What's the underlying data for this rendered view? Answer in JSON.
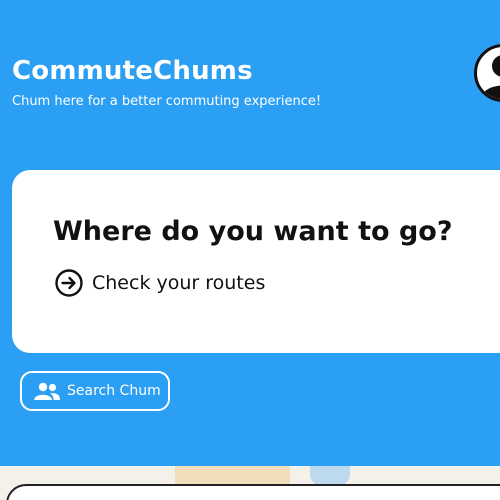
{
  "header": {
    "app_title": "CommuteChums",
    "subtitle": "Chum here for a better commuting experience!"
  },
  "avatar": {
    "icon": "user-avatar-icon"
  },
  "destination_card": {
    "title": "Where do you want to go?",
    "check_routes": {
      "label": "Check your routes",
      "icon": "arrow-right-circle-icon"
    }
  },
  "search_chum": {
    "label": "Search Chum",
    "icon": "group-icon"
  },
  "colors": {
    "primary": "#2b9ff3",
    "card": "#ffffff",
    "text": "#111111"
  }
}
